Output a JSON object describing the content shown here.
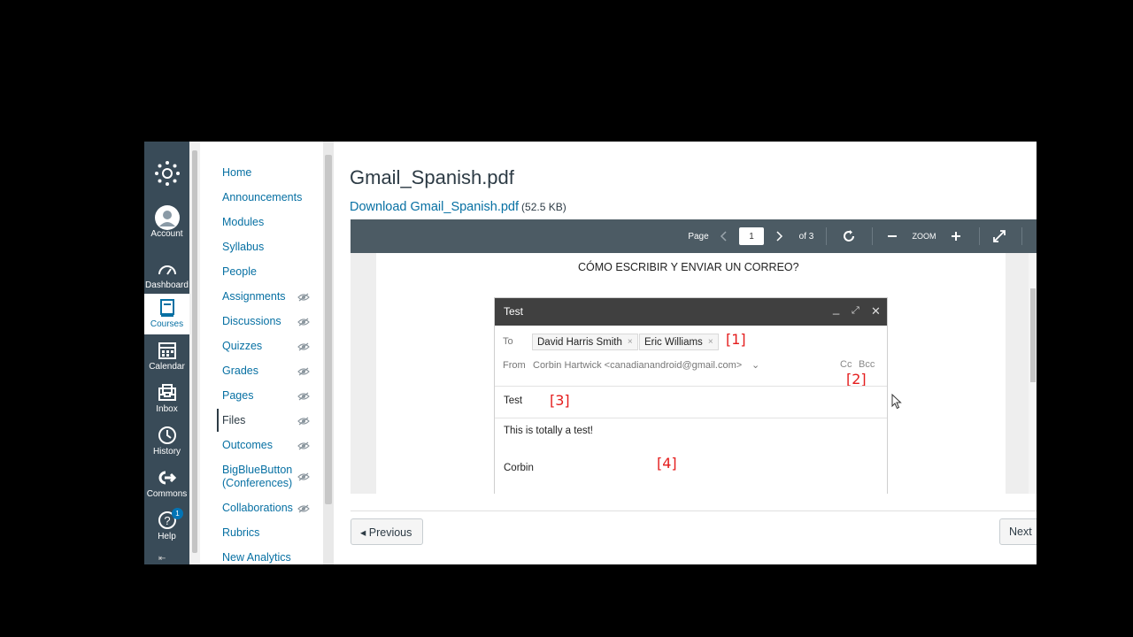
{
  "global_nav": {
    "items": [
      {
        "label": "Account",
        "icon": "account-icon"
      },
      {
        "label": "Dashboard",
        "icon": "dashboard-icon"
      },
      {
        "label": "Courses",
        "icon": "courses-icon",
        "active": true
      },
      {
        "label": "Calendar",
        "icon": "calendar-icon"
      },
      {
        "label": "Inbox",
        "icon": "inbox-icon"
      },
      {
        "label": "History",
        "icon": "history-icon"
      },
      {
        "label": "Commons",
        "icon": "commons-icon"
      },
      {
        "label": "Help",
        "icon": "help-icon",
        "badge": "1"
      }
    ],
    "collapse": "⇤"
  },
  "course_nav": {
    "items": [
      {
        "label": "Home",
        "hidden": false
      },
      {
        "label": "Announcements",
        "hidden": false
      },
      {
        "label": "Modules",
        "hidden": false
      },
      {
        "label": "Syllabus",
        "hidden": false
      },
      {
        "label": "People",
        "hidden": false
      },
      {
        "label": "Assignments",
        "hidden": true
      },
      {
        "label": "Discussions",
        "hidden": true
      },
      {
        "label": "Quizzes",
        "hidden": true
      },
      {
        "label": "Grades",
        "hidden": true
      },
      {
        "label": "Pages",
        "hidden": true
      },
      {
        "label": "Files",
        "hidden": true,
        "active": true
      },
      {
        "label": "Outcomes",
        "hidden": true
      },
      {
        "label": "BigBlueButton",
        "label2": "(Conferences)",
        "hidden": true
      },
      {
        "label": "Collaborations",
        "hidden": true
      },
      {
        "label": "Rubrics",
        "hidden": false
      },
      {
        "label": "New Analytics",
        "hidden": false
      }
    ]
  },
  "content": {
    "title": "Gmail_Spanish.pdf",
    "download_label": "Download Gmail_Spanish.pdf",
    "file_size": "(52.5 KB)"
  },
  "viewer": {
    "page_label": "Page",
    "page_value": "1",
    "of_label": "of 3",
    "zoom_label": "ZOOM",
    "doc_heading": "CÓMO ESCRIBIR Y ENVIAR UN CORREO?",
    "compose": {
      "title": "Test",
      "to_label": "To",
      "recipients": [
        "David Harris Smith",
        "Eric Williams"
      ],
      "from_label": "From",
      "from_value": "Corbin Hartwick <canadianandroid@gmail.com>",
      "cc_label": "Cc",
      "bcc_label": "Bcc",
      "subject": "Test",
      "body_line1": "This is totally a test!",
      "body_line2": "Corbin",
      "annotations": [
        "[1]",
        "[2]",
        "[3]",
        "[4]"
      ]
    }
  },
  "pager": {
    "previous": "◂ Previous",
    "next": "Next"
  },
  "colors": {
    "global_nav_bg": "#394b58",
    "link": "#0770a3",
    "toolbar_bg": "#4c5b64",
    "annotation_red": "#e41c1c"
  }
}
